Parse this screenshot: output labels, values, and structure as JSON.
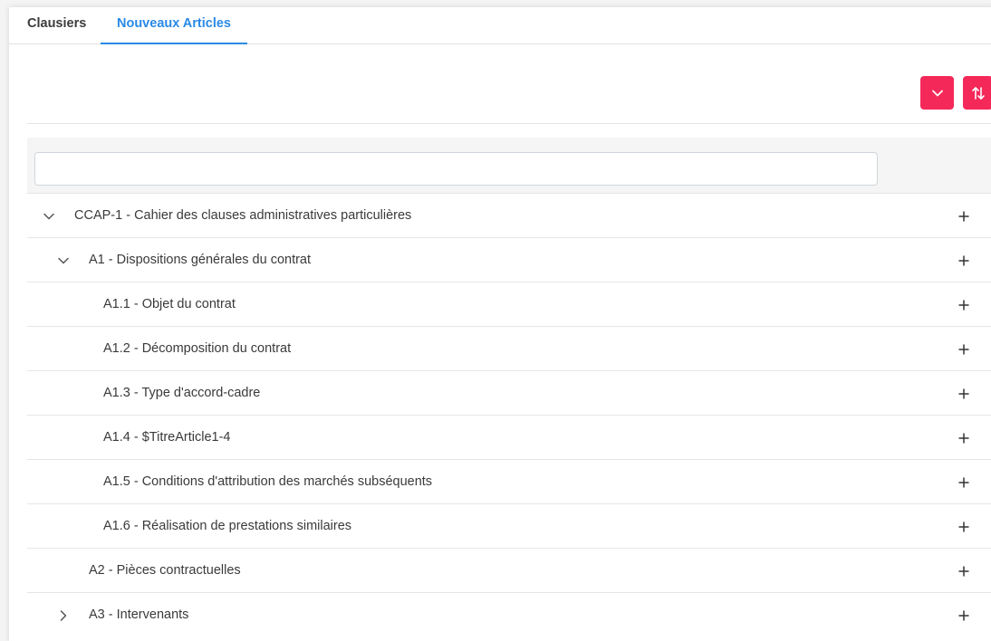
{
  "tabs": [
    {
      "label": "Clausiers",
      "active": false
    },
    {
      "label": "Nouveaux Articles",
      "active": true
    }
  ],
  "toolbar": {
    "expand_icon": "chevron-down-icon",
    "sort_icon": "sort-arrows-icon",
    "accent_color": "#f5285a"
  },
  "search": {
    "value": "",
    "placeholder": ""
  },
  "tree": {
    "root": {
      "label": "CCAP-1 - Cahier des clauses administratives particulières",
      "expanded": true
    },
    "a1": {
      "label": "A1 - Dispositions générales du contrat",
      "expanded": true
    },
    "a1_children": [
      {
        "label": "A1.1 - Objet du contrat"
      },
      {
        "label": "A1.2 - Décomposition du contrat"
      },
      {
        "label": "A1.3 - Type d'accord-cadre"
      },
      {
        "label": "A1.4 - $TitreArticle1-4"
      },
      {
        "label": "A1.5 - Conditions d'attribution des marchés subséquents"
      },
      {
        "label": "A1.6 - Réalisation de prestations similaires"
      }
    ],
    "a2": {
      "label": "A2 - Pièces contractuelles"
    },
    "a3": {
      "label": "A3 - Intervenants",
      "expanded": false
    },
    "add_symbol": "+"
  }
}
